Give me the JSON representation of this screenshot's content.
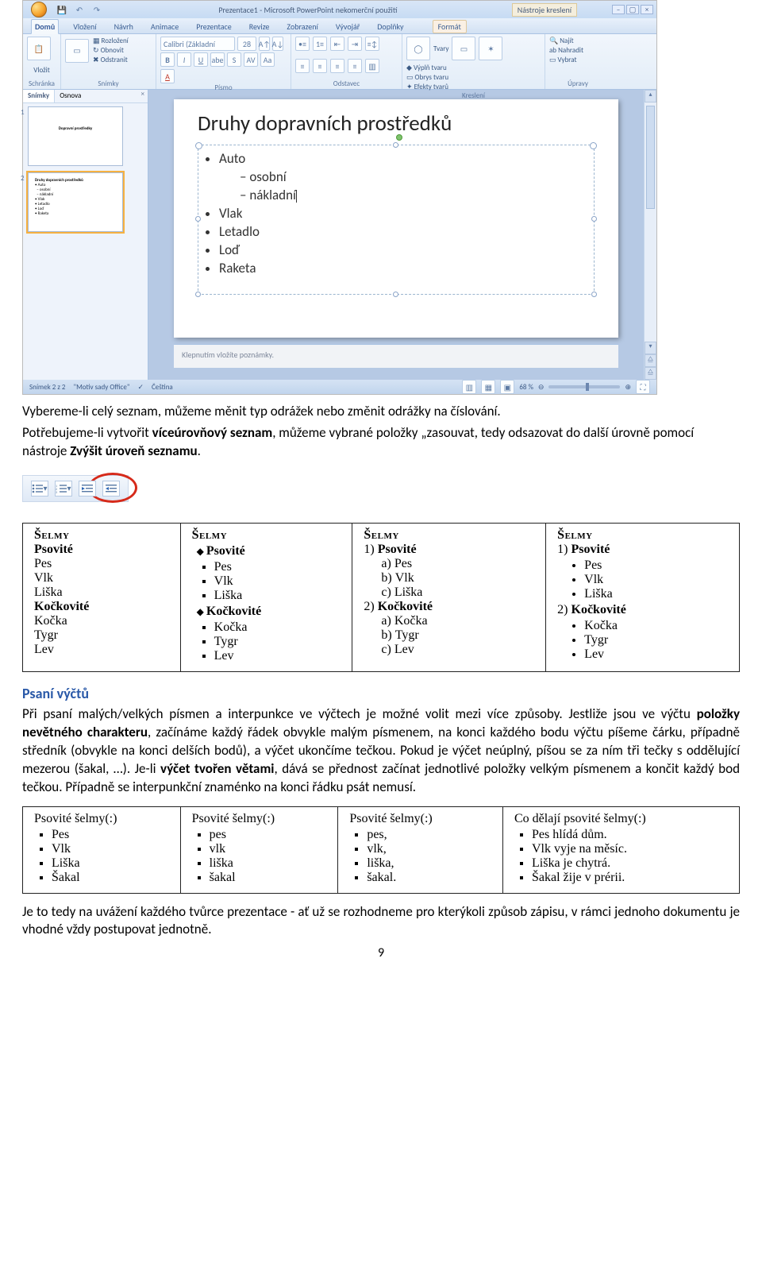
{
  "ppt": {
    "titlebar": "Prezentace1 - Microsoft PowerPoint nekomerční použití",
    "tool_context": "Nástroje kreslení",
    "tabs": [
      "Domů",
      "Vložení",
      "Návrh",
      "Animace",
      "Prezentace",
      "Revize",
      "Zobrazení",
      "Vývojář",
      "Doplňky",
      "Formát"
    ],
    "groups": {
      "schranka": {
        "label": "Schránka",
        "paste": "Vložit"
      },
      "snimky": {
        "label": "Snímky",
        "new": "Nový snímek",
        "layout": "Rozložení",
        "reset": "Obnovit",
        "delete": "Odstranit"
      },
      "pismo": {
        "label": "Písmo",
        "font": "Calibri (Základní",
        "size": "28"
      },
      "odstavec": {
        "label": "Odstavec"
      },
      "kresleni": {
        "label": "Kreslení",
        "shapes": "Tvary",
        "arrange": "Uspořádat",
        "quick": "Rychlé styly",
        "fill": "Výplň tvaru",
        "outline": "Obrys tvaru",
        "effects": "Efekty tvarů"
      },
      "upravy": {
        "label": "Úpravy",
        "find": "Najít",
        "replace": "Nahradit",
        "select": "Vybrat"
      }
    },
    "nav": {
      "slides": "Snímky",
      "outline": "Osnova"
    },
    "slide": {
      "title": "Druhy dopravních prostředků",
      "items": [
        "Auto",
        "Vlak",
        "Letadlo",
        "Loď",
        "Raketa"
      ],
      "auto_sub": [
        "osobní",
        "nákladní"
      ]
    },
    "notes_placeholder": "Klepnutím vložíte poznámky.",
    "status": {
      "left1": "Snímek 2 z 2",
      "left2": "\"Motiv sady Office\"",
      "lang": "Čeština",
      "zoom": "68 %"
    }
  },
  "body": {
    "p1a": "Vybereme-li celý seznam, můžeme měnit typ odrážek nebo změnit odrážky na číslování.",
    "p1b_pre": "Potřebujeme-li vytvořit ",
    "p1b_b": "víceúrovňový seznam",
    "p1b_mid": ", můžeme vybrané položky „zasouvat, tedy odsazovat do další úrovně pomocí nástroje ",
    "p1b_b2": "Zvýšit úroveň seznamu",
    "p1b_end": ".",
    "h_psani": "Psaní výčtů",
    "p2a": "Při psaní malých/velkých písmen a interpunkce ve výčtech je možné volit mezi více způsoby. Jestliže jsou ve výčtu ",
    "p2a_b": "položky nevětného charakteru",
    "p2a_mid": ", začínáme každý řádek obvykle malým písmenem, na konci každého bodu výčtu píšeme čárku, případně středník (obvykle na konci delších bodů), a výčet ukončíme tečkou. Pokud je výčet neúplný, píšou se za ním tři tečky s oddělující mezerou (šakal, …). Je-li ",
    "p2a_b2": "výčet tvořen větami",
    "p2a_end": ", dává se přednost začínat jednotlivé položky velkým písmenem a končit každý bod tečkou. Případně se interpunkční znaménko na konci řádku psát nemusí.",
    "p3": "Je to tedy na uvážení každého tvůrce prezentace - ať už se rozhodneme pro kterýkoli způsob zápisu, v rámci jednoho dokumentu je vhodné vždy postupovat jednotně.",
    "pagenum": "9"
  },
  "table1": {
    "hdr": "Šelmy",
    "psovite": "Psovité",
    "kockovite": "Kočkovité",
    "pes": "Pes",
    "vlk": "Vlk",
    "liska": "Liška",
    "kocka": "Kočka",
    "tygr": "Tygr",
    "lev": "Lev"
  },
  "table2": {
    "hdr1": "Psovité šelmy(:)",
    "hdr4": "Co dělají psovité šelmy(:)",
    "c1": [
      "Pes",
      "Vlk",
      "Liška",
      "Šakal"
    ],
    "c2": [
      "pes",
      "vlk",
      "liška",
      "šakal"
    ],
    "c3": [
      "pes,",
      "vlk,",
      "liška,",
      "šakal."
    ],
    "c4": [
      "Pes hlídá dům.",
      "Vlk vyje na měsíc.",
      "Liška je chytrá.",
      "Šakal žije v prérii."
    ]
  }
}
